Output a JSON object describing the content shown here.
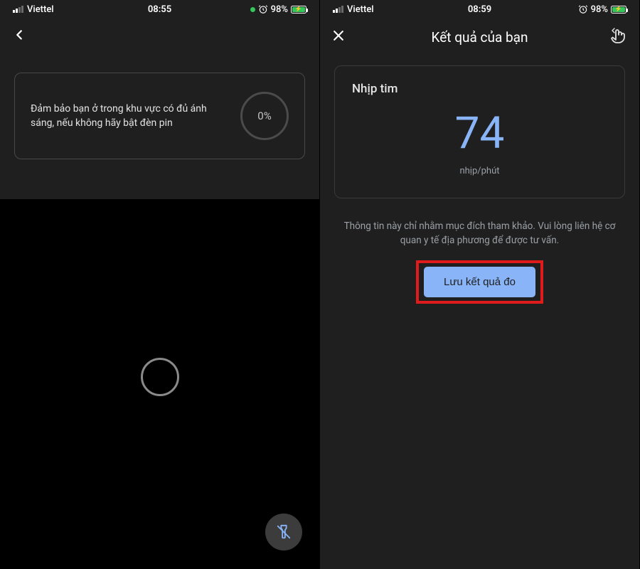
{
  "left": {
    "status": {
      "carrier": "Viettel",
      "time": "08:55",
      "battery_pct": "98%"
    },
    "card": {
      "instruction": "Đảm bảo bạn ở trong khu vực có đủ ánh sáng, nếu không hãy bật đèn pin",
      "progress": "0%"
    }
  },
  "right": {
    "status": {
      "carrier": "Viettel",
      "time": "08:59",
      "battery_pct": "98%"
    },
    "nav": {
      "title": "Kết quả của bạn"
    },
    "result": {
      "label": "Nhịp tim",
      "value": "74",
      "unit": "nhịp/phút"
    },
    "disclaimer": "Thông tin này chỉ nhằm mục đích tham khảo. Vui lòng liên hệ cơ quan y tế địa phương để được tư vấn.",
    "save_label": "Lưu kết quả đo"
  }
}
